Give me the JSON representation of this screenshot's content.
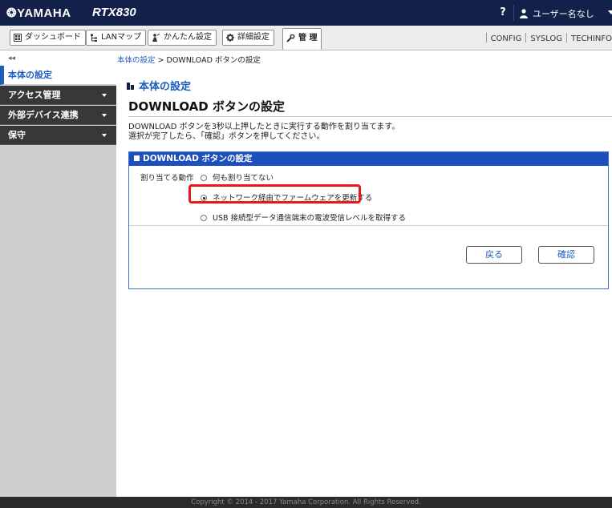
{
  "header": {
    "logo": "❂YAMAHA",
    "model": "RTX830",
    "help": "?",
    "user": "ユーザー名なし"
  },
  "toolbar": {
    "tabs": [
      {
        "label": "ダッシュボード",
        "icon": "dashboard-icon"
      },
      {
        "label": "LANマップ",
        "icon": "lan-map-icon"
      },
      {
        "label": "かんたん設定",
        "icon": "wizard-icon"
      },
      {
        "label": "詳細設定",
        "icon": "gear-icon"
      },
      {
        "label": "管 理",
        "icon": "wrench-icon"
      }
    ],
    "links": [
      "CONFIG",
      "SYSLOG",
      "TECHINFO"
    ]
  },
  "breadcrumb": {
    "parent": "本体の設定",
    "current": " > DOWNLOAD ボタンの設定"
  },
  "sidebar": {
    "collapse": "◂◂",
    "items": [
      {
        "label": "本体の設定",
        "active": true
      },
      {
        "label": "アクセス管理"
      },
      {
        "label": "外部デバイス連携"
      },
      {
        "label": "保守"
      }
    ]
  },
  "main": {
    "section_title": "本体の設定",
    "page_title": "DOWNLOAD ボタンの設定",
    "desc_line1": "DOWNLOAD ボタンを3秒以上押したときに実行する動作を割り当てます。",
    "desc_line2": "選択が完了したら、「確認」ボタンを押してください。",
    "panel_title": "DOWNLOAD ボタンの設定",
    "field_label": "割り当てる動作",
    "options": [
      {
        "label": "何も割り当てない",
        "selected": false
      },
      {
        "label": "ネットワーク経由でファームウェアを更新する",
        "selected": true
      },
      {
        "label": "USB 接続型データ通信端末の電波受信レベルを取得する",
        "selected": false
      }
    ],
    "back_label": "戻る",
    "confirm_label": "確認"
  },
  "footer": "Copyright © 2014 - 2017 Yamaha Corporation. All Rights Reserved.",
  "colors": {
    "header_bg": "#13204a",
    "accent": "#1d5fbf",
    "panel_head": "#1d4fbf",
    "highlight": "#e61919"
  }
}
